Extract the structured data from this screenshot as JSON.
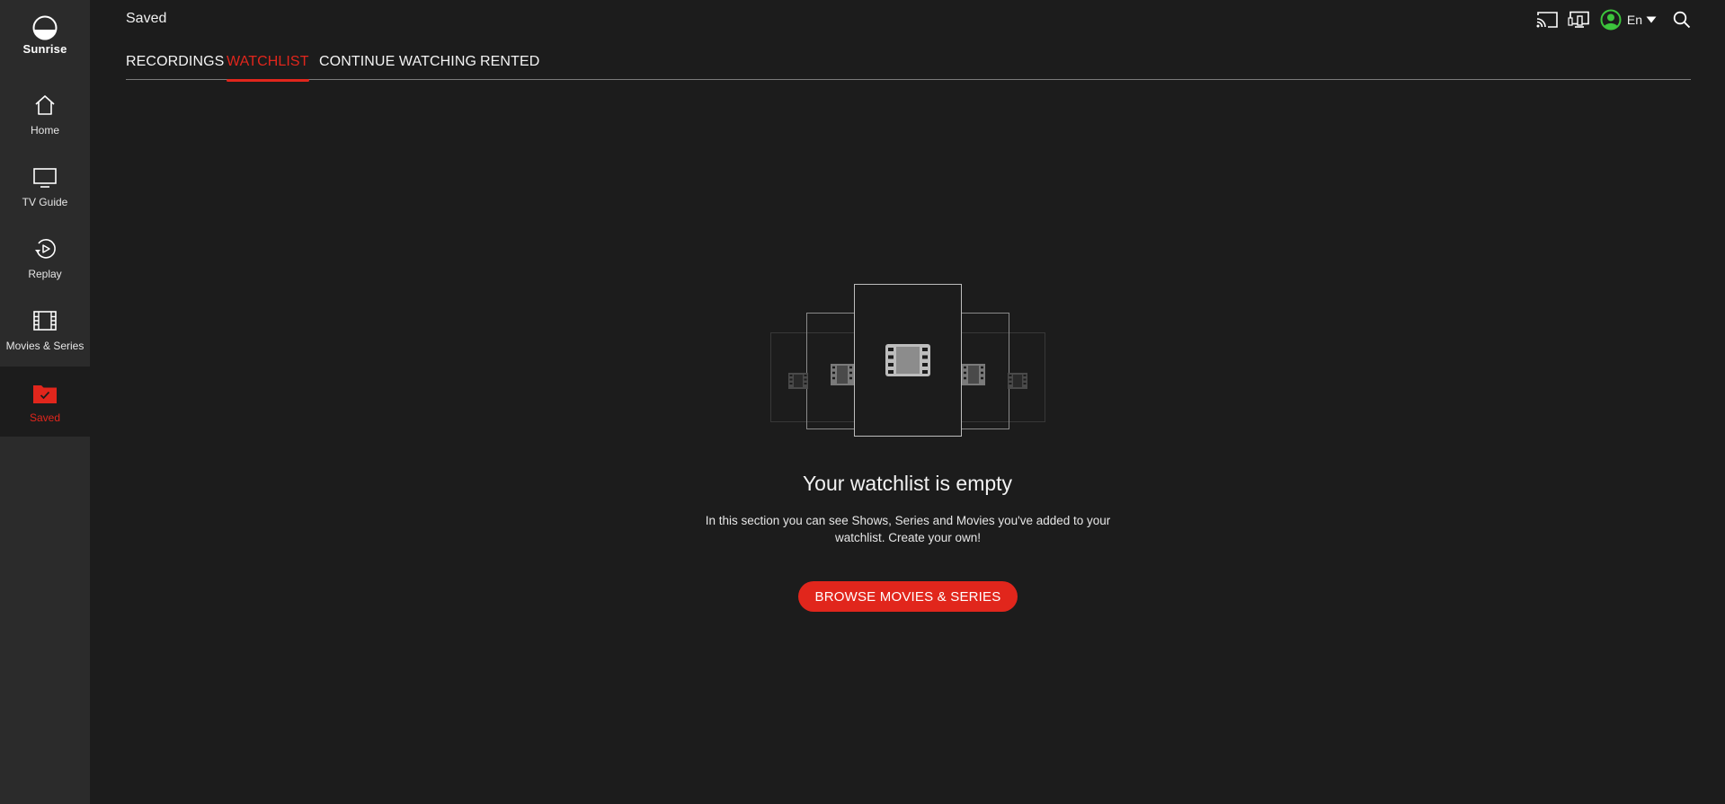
{
  "app": {
    "brand": "Sunrise",
    "accent_color": "#e1261c"
  },
  "page": {
    "title": "Saved"
  },
  "sidebar": {
    "items": [
      {
        "label": "Home",
        "icon": "home-icon"
      },
      {
        "label": "TV Guide",
        "icon": "tv-icon"
      },
      {
        "label": "Replay",
        "icon": "replay-icon"
      },
      {
        "label": "Movies & Series",
        "icon": "film-icon"
      },
      {
        "label": "Saved",
        "icon": "saved-folder-icon",
        "active": true
      }
    ]
  },
  "topbar": {
    "icons": [
      "cast-icon",
      "devices-icon",
      "profile-icon",
      "chevron-down-icon",
      "search-icon"
    ],
    "language": "En"
  },
  "tabs": [
    {
      "label": "RECORDINGS"
    },
    {
      "label": "WATCHLIST",
      "active": true
    },
    {
      "label": "CONTINUE WATCHING"
    },
    {
      "label": "RENTED"
    }
  ],
  "empty_state": {
    "title": "Your watchlist is empty",
    "description": "In this section you can see Shows, Series and Movies you've added to your watchlist. Create your own!",
    "button_label": "BROWSE MOVIES & SERIES"
  }
}
